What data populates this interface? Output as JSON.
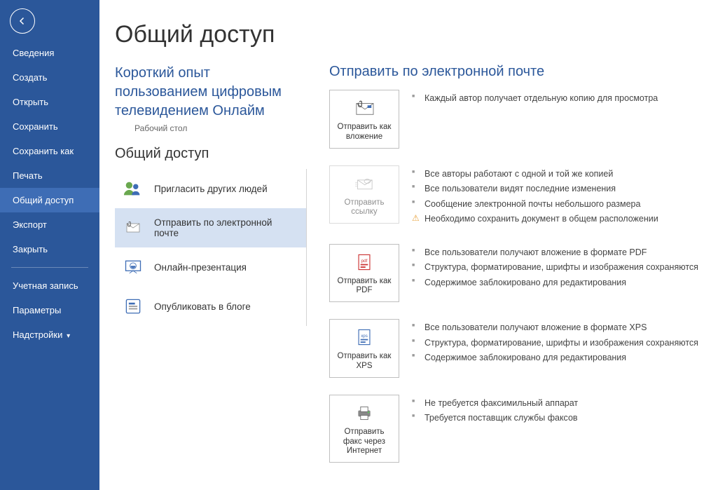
{
  "sidebar": {
    "items": [
      {
        "label": "Сведения"
      },
      {
        "label": "Создать"
      },
      {
        "label": "Открыть"
      },
      {
        "label": "Сохранить"
      },
      {
        "label": "Сохранить как"
      },
      {
        "label": "Печать"
      },
      {
        "label": "Общий доступ"
      },
      {
        "label": "Экспорт"
      },
      {
        "label": "Закрыть"
      }
    ],
    "footer": [
      {
        "label": "Учетная запись"
      },
      {
        "label": "Параметры"
      },
      {
        "label": "Надстройки"
      }
    ]
  },
  "page": {
    "title": "Общий доступ",
    "doc_title_l1": "Короткий опыт",
    "doc_title_l2": "пользованием цифровым",
    "doc_title_l3": "телевидением Онлайм",
    "doc_location": "Рабочий стол",
    "share_header": "Общий доступ"
  },
  "share_options": [
    {
      "label": "Пригласить других людей"
    },
    {
      "label": "Отправить по электронной почте"
    },
    {
      "label": "Онлайн-презентация"
    },
    {
      "label": "Опубликовать в блоге"
    }
  ],
  "email": {
    "title": "Отправить по электронной почте",
    "opts": [
      {
        "btn": "Отправить как вложение",
        "bullets": [
          "Каждый автор получает отдельную копию для просмотра"
        ]
      },
      {
        "btn": "Отправить ссылку",
        "disabled": true,
        "bullets": [
          "Все авторы работают с одной и той же копией",
          "Все пользователи видят последние изменения",
          "Сообщение электронной почты небольшого размера"
        ],
        "warn": "Необходимо сохранить документ в общем расположении"
      },
      {
        "btn": "Отправить как PDF",
        "bullets": [
          "Все пользователи получают вложение в формате PDF",
          "Структура, форматирование, шрифты и изображения сохраняются",
          "Содержимое заблокировано для редактирования"
        ]
      },
      {
        "btn": "Отправить как XPS",
        "bullets": [
          "Все пользователи получают вложение в формате XPS",
          "Структура, форматирование, шрифты и изображения сохраняются",
          "Содержимое заблокировано для редактирования"
        ]
      },
      {
        "btn": "Отправить факс через Интернет",
        "bullets": [
          "Не требуется факсимильный аппарат",
          "Требуется поставщик службы факсов"
        ]
      }
    ]
  }
}
